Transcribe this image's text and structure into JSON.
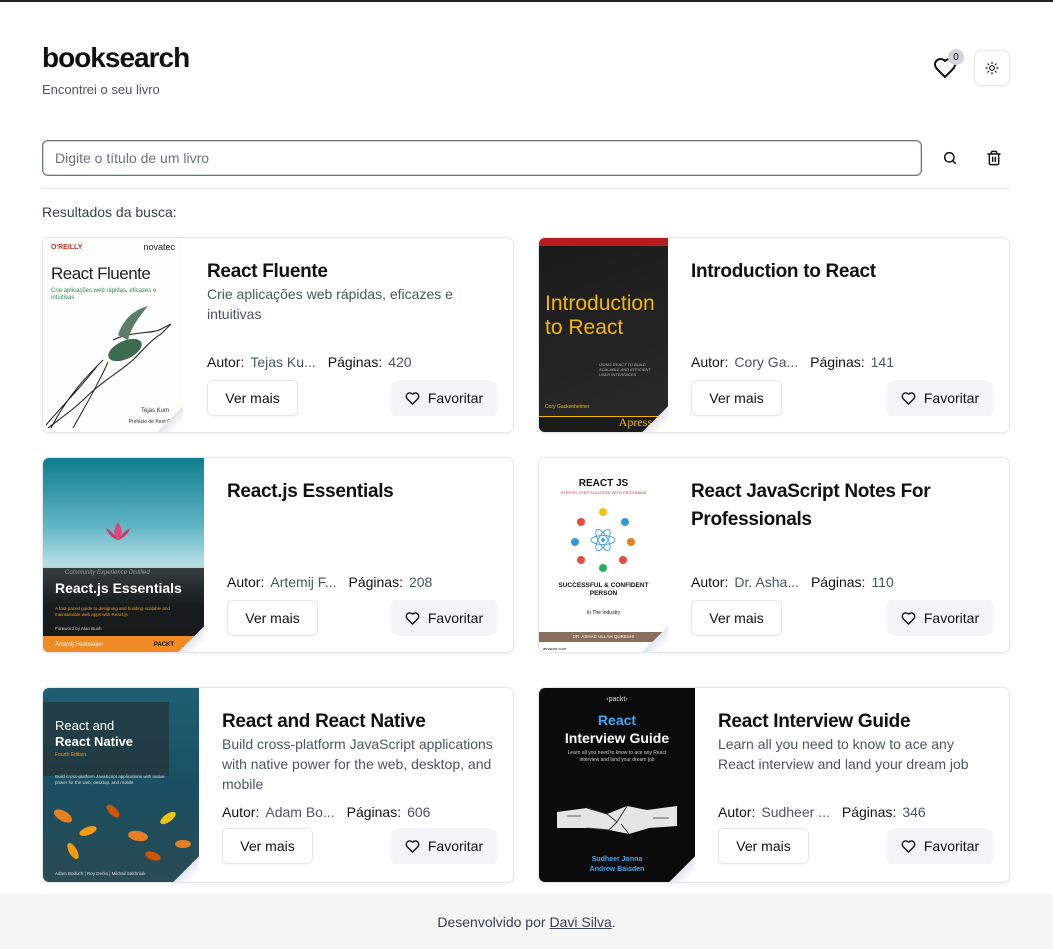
{
  "app": {
    "brand": "booksearch",
    "tagline": "Encontrei o seu livro",
    "favorites_count": "0"
  },
  "search": {
    "placeholder": "Digite o título de um livro",
    "value": ""
  },
  "results_label": "Resultados da busca:",
  "labels": {
    "author": "Autor:",
    "pages": "Páginas:",
    "more": "Ver mais",
    "favorite": "Favoritar"
  },
  "books": [
    {
      "title": "React Fluente",
      "subtitle": "Crie aplicações web rápidas, eficazes e intuitivas",
      "author": "Tejas Ku...",
      "pages": "420",
      "cover": {
        "publisher": "O'REILLY",
        "publisher2": "novatec",
        "title": "React Fluente",
        "sub": "Crie aplicações web rápidas, eficazes e intuitivas",
        "author": "Tejas Kum",
        "foreword": "Prefácio de Kent C. D"
      }
    },
    {
      "title": "Introduction to React",
      "subtitle": "",
      "author": "Cory Ga...",
      "pages": "141",
      "cover": {
        "title1": "Introduction",
        "title2": "to React",
        "tag": "USING REACT TO BUILD SCALABLE AND EFFICIENT USER INTERFACES",
        "author": "Cory Gackenheimer",
        "publisher": "Apress"
      }
    },
    {
      "title": "React.js Essentials",
      "subtitle": "",
      "author": "Artemij F...",
      "pages": "208",
      "cover": {
        "edition": "Community Experience Distilled",
        "title": "React.js Essentials",
        "desc": "A fast-paced guide to designing and building scalable and maintainable web apps with React.js",
        "foreword": "Foreword by Alan Bush",
        "author": "Artemij Fedosejev",
        "publisher": "PACKT"
      }
    },
    {
      "title": "React JavaScript Notes For Professionals",
      "subtitle": "",
      "author": "Dr. Asha...",
      "pages": "110",
      "cover": {
        "title": "REACT JS",
        "sub": "STEP BY STEP SOLUTION WITH PROGRAMS",
        "tag1": "SUCCESSFUL & CONFIDENT",
        "tag2": "PERSON",
        "tag3": "In The Industry",
        "author": "DR. ASHAD ULLAH QURESHI",
        "store": "amazon.com"
      }
    },
    {
      "title": "React and React Native",
      "subtitle": "Build cross-platform JavaScript applications with native power for the web, desktop, and mobile",
      "author": "Adam Bo...",
      "pages": "606",
      "cover": {
        "title1": "React and",
        "title2": "React Native",
        "edition": "Fourth Edition",
        "desc": "Build cross-platform JavaScript applications with native power for the web, desktop, and mobile",
        "authors": "Adam Boduch | Roy Derks | Mikhail Sakhniuk"
      }
    },
    {
      "title": "React Interview Guide",
      "subtitle": "Learn all you need to know to ace any React interview and land your dream job",
      "author": "Sudheer ...",
      "pages": "346",
      "cover": {
        "publisher": "‹packt›",
        "title1": "React",
        "title2": "Interview Guide",
        "desc": "Learn all you need to know to ace any React interview and land your dream job",
        "author1": "Sudheer Jonna",
        "author2": "Andrew Baisden"
      }
    }
  ],
  "footer": {
    "prefix": "Desenvolvido por",
    "author": "Davi Silva",
    "suffix": "."
  },
  "colors": {
    "accent": "#111827",
    "muted": "#4b5563",
    "border": "#e5e7eb",
    "button_bg": "#f3f4f6",
    "footer_bg": "#f5f5f5"
  }
}
